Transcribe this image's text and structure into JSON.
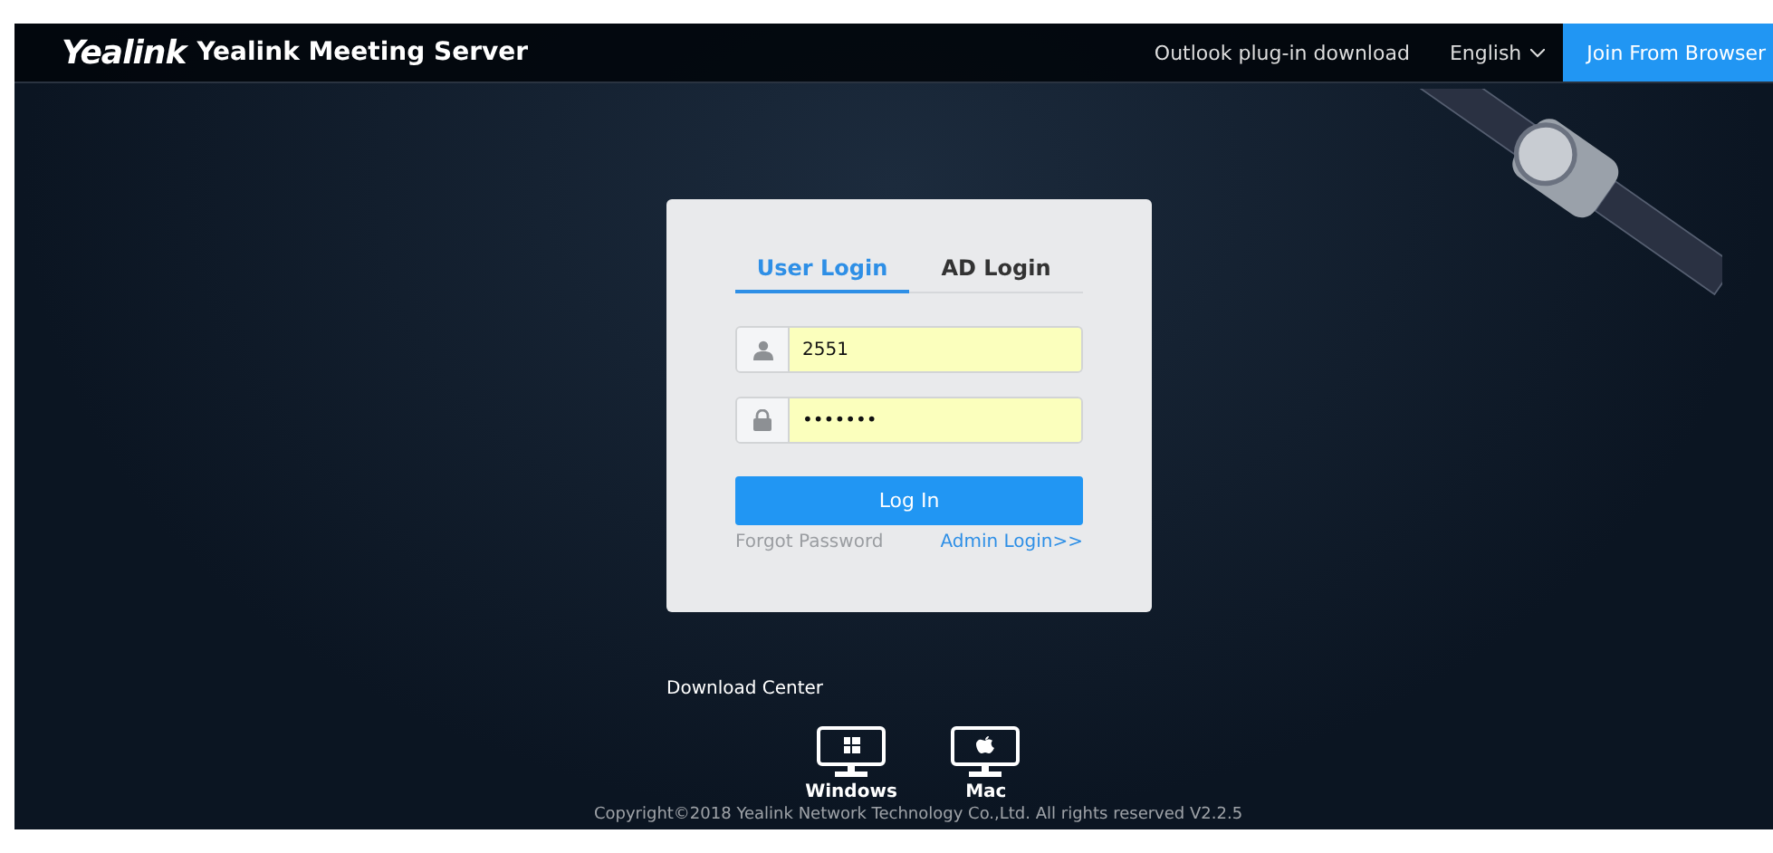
{
  "header": {
    "logo": "Yealink",
    "title": "Yealink Meeting Server",
    "links": [
      {
        "label": "Outlook plug-in download"
      }
    ],
    "language": {
      "label": "English",
      "expanded": false
    },
    "join_button": "Join From Browser"
  },
  "login": {
    "tabs": [
      {
        "label": "User Login",
        "selected": true
      },
      {
        "label": "AD Login",
        "selected": false
      }
    ],
    "username": {
      "value": "2551"
    },
    "password": {
      "value": "•••••••"
    },
    "submit": "Log In",
    "forgot": "Forgot Password",
    "admin": "Admin Login>>"
  },
  "downloads": {
    "title": "Download Center",
    "items": [
      {
        "kind": "windows",
        "label": "Windows"
      },
      {
        "kind": "mac",
        "label": "Mac"
      }
    ]
  },
  "footer": "Copyright©2018 Yealink Network Technology Co.,Ltd. All rights reserved V2.2.5"
}
